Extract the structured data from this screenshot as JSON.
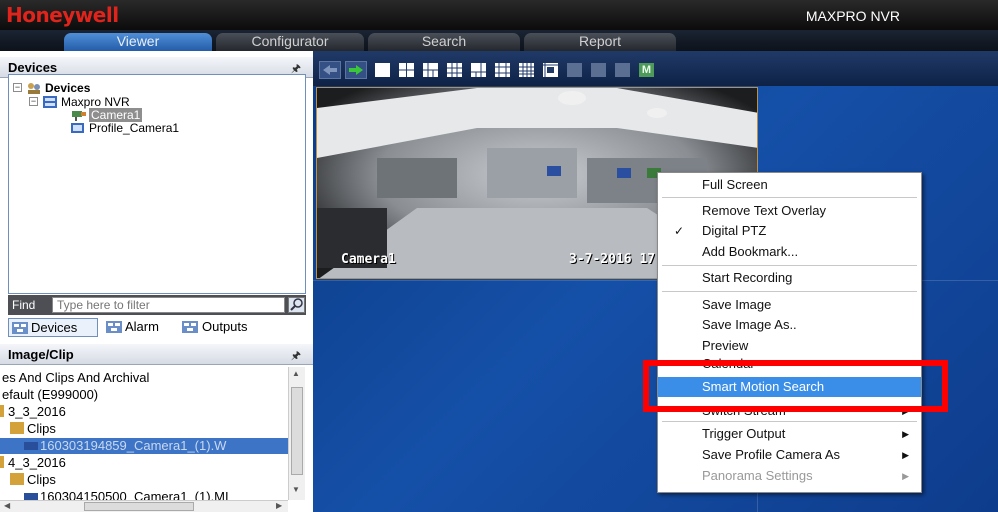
{
  "app": {
    "brand": "Honeywell",
    "title": "MAXPRO NVR",
    "tabs": [
      {
        "label": "Viewer",
        "active": true
      },
      {
        "label": "Configurator",
        "active": false
      },
      {
        "label": "Search",
        "active": false
      },
      {
        "label": "Report",
        "active": false
      }
    ]
  },
  "devices_panel": {
    "title": "Devices",
    "pin_icon": "pin-icon",
    "tree": [
      {
        "label": "Devices",
        "level": 0,
        "icon": "devices-icon"
      },
      {
        "label": "Maxpro NVR",
        "level": 1,
        "icon": "nvr-icon"
      },
      {
        "label": "Camera1",
        "level": 2,
        "icon": "camera-icon",
        "selected": true
      },
      {
        "label": "Profile_Camera1",
        "level": 2,
        "icon": "profile-camera-icon"
      }
    ],
    "find_label": "Find",
    "find_placeholder": "Type here to filter",
    "subtabs": [
      {
        "label": "Devices",
        "active": true
      },
      {
        "label": "Alarm",
        "active": false
      },
      {
        "label": "Outputs",
        "active": false
      }
    ]
  },
  "clips_panel": {
    "title": "Image/Clip",
    "rows": [
      {
        "text": "es And Clips And Archival",
        "indent": 0
      },
      {
        "text": "efault (E999000)",
        "indent": 0
      },
      {
        "text": "3_3_2016",
        "indent": 1,
        "folder": true
      },
      {
        "text": "Clips",
        "indent": 2,
        "folder": true
      },
      {
        "text": "160303194859_Camera1_(1).W",
        "indent": 3,
        "selected": true
      },
      {
        "text": "4_3_2016",
        "indent": 1,
        "folder": true
      },
      {
        "text": "Clips",
        "indent": 2,
        "folder": true
      },
      {
        "text": "160304150500_Camera1_(1).MI",
        "indent": 3
      }
    ]
  },
  "video": {
    "camera_label": "Camera1",
    "timestamp": "3-7-2016 17:",
    "toolbar_buttons": [
      "back-arrow-icon",
      "forward-arrow-icon",
      "layout-1x1-icon",
      "layout-2x2-icon",
      "layout-1plus3-icon",
      "layout-3x3-icon",
      "layout-1plus5-icon",
      "layout-1plus7-icon",
      "layout-4x4-icon",
      "layout-custom-icon",
      "layout-disabled-1-icon",
      "layout-disabled-2-icon",
      "layout-disabled-3-icon",
      "layout-m-icon"
    ],
    "m_label": "M"
  },
  "context_menu": {
    "items": [
      {
        "label": "Full Screen"
      },
      {
        "label": "Remove Text Overlay"
      },
      {
        "label": "Digital PTZ",
        "checked": true
      },
      {
        "label": "Add Bookmark..."
      },
      {
        "label": "Start Recording"
      },
      {
        "label": "Save Image"
      },
      {
        "label": "Save Image As.."
      },
      {
        "label": "Preview"
      },
      {
        "label": "Calendar"
      },
      {
        "label": "Smart Motion Search",
        "highlighted": true
      },
      {
        "label": "Switch Stream",
        "submenu": true
      },
      {
        "label": "Trigger Output",
        "submenu": true
      },
      {
        "label": "Save Profile Camera As",
        "submenu": true
      },
      {
        "label": "Panorama Settings",
        "submenu": true,
        "disabled": true
      }
    ]
  },
  "colors": {
    "brand_red": "#e0241c",
    "active_tab": "#3a78c8",
    "menu_highlight": "#3b8ee8",
    "annotation_red": "#ff0000",
    "video_bg": "#1550a8"
  }
}
